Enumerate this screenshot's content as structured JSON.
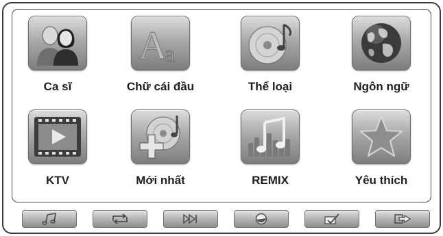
{
  "menu": {
    "items": [
      {
        "label": "Ca sĩ",
        "icon": "singer-icon"
      },
      {
        "label": "Chữ cái đầu",
        "icon": "alphabet-icon"
      },
      {
        "label": "Thể loại",
        "icon": "genre-disc-icon"
      },
      {
        "label": "Ngôn ngữ",
        "icon": "globe-icon"
      },
      {
        "label": "KTV",
        "icon": "video-icon"
      },
      {
        "label": "Mới nhất",
        "icon": "new-disc-icon"
      },
      {
        "label": "REMIX",
        "icon": "remix-icon"
      },
      {
        "label": "Yêu thích",
        "icon": "star-icon"
      }
    ]
  },
  "toolbar": {
    "buttons": [
      {
        "icon": "music-note-icon"
      },
      {
        "icon": "repeat-icon"
      },
      {
        "icon": "skip-forward-icon"
      },
      {
        "icon": "record-icon"
      },
      {
        "icon": "checklist-icon"
      },
      {
        "icon": "exit-icon"
      }
    ]
  },
  "colors": {
    "frame": "#3a3a3a",
    "tile_top": "#dcdcdc",
    "tile_bottom": "#7d7d7d",
    "label": "#1e1e1e"
  }
}
